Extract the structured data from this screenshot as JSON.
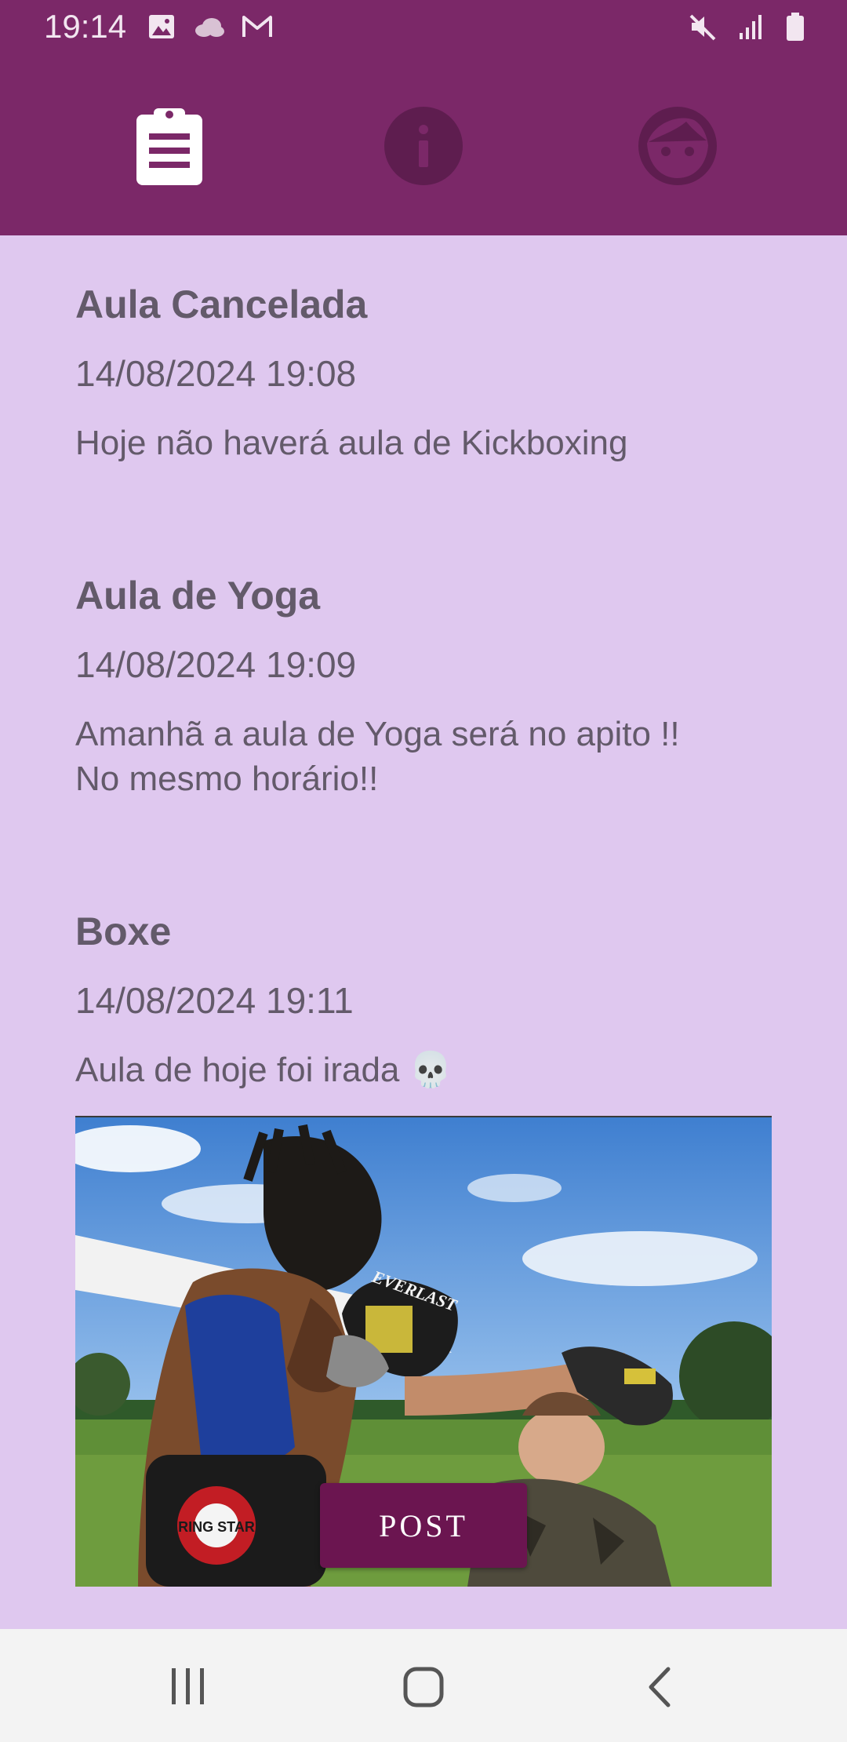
{
  "status_bar": {
    "time": "19:14",
    "left_icons": [
      "image-icon",
      "cloud-icon",
      "gmail-icon"
    ],
    "right_icons": [
      "mute-icon",
      "signal-icon",
      "battery-icon"
    ]
  },
  "header": {
    "tabs": [
      {
        "name": "tab-feed",
        "icon": "clipboard-icon",
        "selected": true
      },
      {
        "name": "tab-info",
        "icon": "info-icon",
        "selected": false
      },
      {
        "name": "tab-profile",
        "icon": "face-icon",
        "selected": false
      }
    ],
    "background": "#7b2868"
  },
  "posts": [
    {
      "title": "Aula Cancelada",
      "date": "14/08/2024 19:08",
      "body": "Hoje não haverá aula de Kickboxing"
    },
    {
      "title": "Aula de Yoga",
      "date": "14/08/2024 19:09",
      "body": "Amanhã a aula de Yoga será no apito !!\nNo mesmo horário!!"
    },
    {
      "title": "Boxe",
      "date": "14/08/2024 19:11",
      "body": "Aula de hoje foi irada 💀"
    }
  ],
  "post_image": {
    "brand_text": "EVERLAST",
    "pad_text": "RING STAR"
  },
  "post_button": {
    "label": "POST",
    "color": "#6b1550"
  },
  "nav": {
    "items": [
      "recents-icon",
      "home-icon",
      "back-icon"
    ]
  },
  "colors": {
    "background": "#dfc8ef",
    "text": "#635a6a",
    "accent": "#7b2868"
  }
}
